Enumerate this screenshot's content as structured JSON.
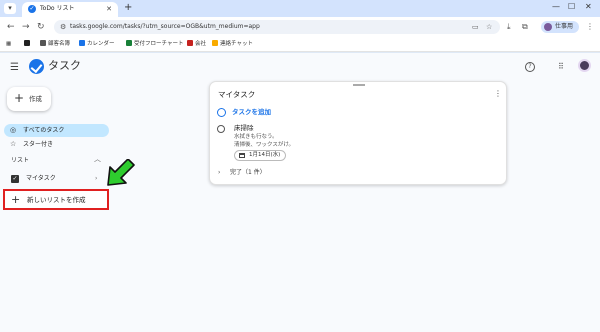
{
  "browser": {
    "tab_title": "ToDo リスト",
    "url": "tasks.google.com/tasks/?utm_source=OGB&utm_medium=app",
    "profile_label": "仕事用",
    "bookmarks": [
      {
        "label": "顧客名簿",
        "color": "#555555"
      },
      {
        "label": "カレンダー",
        "color": "#1a73e8"
      },
      {
        "label": "受付フローチャート",
        "color": "#188038"
      },
      {
        "label": "会社",
        "color": "#c5221f"
      },
      {
        "label": "連絡チャット",
        "color": "#f9ab00"
      }
    ]
  },
  "app": {
    "title": "タスク",
    "create_label": "作成"
  },
  "sidebar": {
    "nav": [
      {
        "icon": "all-tasks-icon",
        "label": "すべてのタスク",
        "active": true
      },
      {
        "icon": "star-icon",
        "label": "スター付き",
        "active": false
      }
    ],
    "section_label": "リスト",
    "lists": [
      {
        "label": "マイタスク",
        "checked": true
      }
    ],
    "new_list_label": "新しいリストを作成"
  },
  "panel": {
    "title": "マイタスク",
    "add_task_label": "タスクを追加",
    "tasks": [
      {
        "title": "床掃除",
        "notes": "水拭きも行なう。\n清掃後、ワックスがけ。",
        "date": "1月14日(水)"
      }
    ],
    "completed_label": "完了（1 件）"
  },
  "colors": {
    "accent": "#1a73e8",
    "highlight": "#e02020",
    "arrow": "#2ecc2e"
  }
}
